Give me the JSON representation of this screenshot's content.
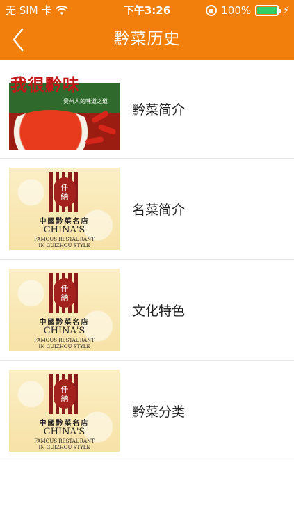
{
  "status_bar": {
    "carrier": "无 SIM 卡",
    "time": "下午3:26",
    "battery_percent": "100%",
    "battery_level": 1.0,
    "icons": [
      "wifi-icon",
      "orientation-lock-icon",
      "battery-icon",
      "charging-icon"
    ]
  },
  "nav": {
    "title": "黔菜历史",
    "back_icon": "chevron-left-icon",
    "background": "#f27f0c"
  },
  "list": {
    "items": [
      {
        "label": "黔菜简介",
        "thumb": "spicy-dish-image",
        "thumb_text": "我很黔味",
        "thumb_slogan": "贵州人的味道之道"
      },
      {
        "label": "名菜简介",
        "thumb": "restaurant-logo-image",
        "seal_text": "仟\n納",
        "logo_cn": "中國黔菜名店",
        "logo_en": "CHINA'S",
        "logo_sub1": "FAMOUS RESTAURANT",
        "logo_sub2": "IN GUIZHOU STYLE"
      },
      {
        "label": "文化特色",
        "thumb": "restaurant-logo-image",
        "seal_text": "仟\n納",
        "logo_cn": "中國黔菜名店",
        "logo_en": "CHINA'S",
        "logo_sub1": "FAMOUS RESTAURANT",
        "logo_sub2": "IN GUIZHOU STYLE"
      },
      {
        "label": "黔菜分类",
        "thumb": "restaurant-logo-image",
        "seal_text": "仟\n納",
        "logo_cn": "中國黔菜名店",
        "logo_en": "CHINA'S",
        "logo_sub1": "FAMOUS RESTAURANT",
        "logo_sub2": "IN GUIZHOU STYLE"
      }
    ]
  }
}
